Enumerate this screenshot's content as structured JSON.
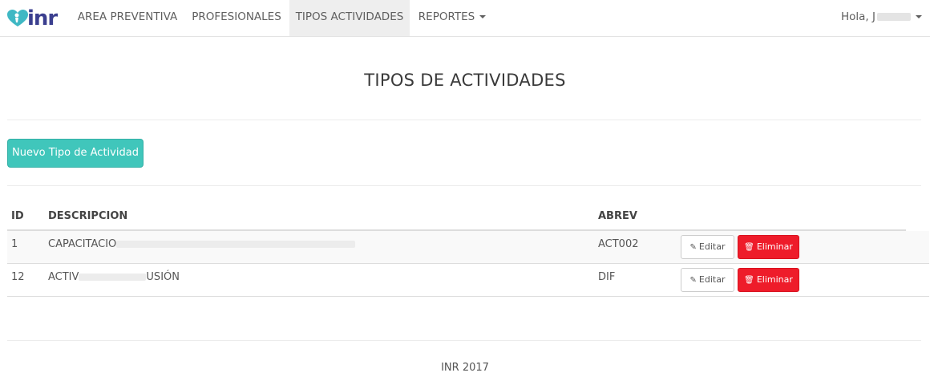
{
  "navbar": {
    "brand": "inr",
    "items": [
      {
        "label": "AREA PREVENTIVA"
      },
      {
        "label": "PROFESIONALES"
      },
      {
        "label": "TIPOS ACTIVIDADES"
      },
      {
        "label": "REPORTES"
      }
    ],
    "active_item": "TIPOS ACTIVIDADES",
    "user_greeting": "Hola, J"
  },
  "page": {
    "title": "TIPOS DE ACTIVIDADES",
    "new_button_label": "Nuevo Tipo de Actividad"
  },
  "table": {
    "columns": [
      "ID",
      "DESCRIPCION",
      "ABREV"
    ],
    "rows": [
      {
        "id": "1",
        "descripcion": "CAPACITACIO",
        "descripcion_tail": "",
        "abrev": "ACT002"
      },
      {
        "id": "12",
        "descripcion": "ACTIV",
        "descripcion_tail": "USIÓN",
        "abrev": "DIF"
      }
    ],
    "edit_label": "Editar",
    "delete_label": "Eliminar"
  },
  "footer": {
    "text": "INR 2017"
  },
  "colors": {
    "primary_button": "#40c6bb",
    "danger_button": "#ee1c2a",
    "brand": "#3b3f8f",
    "brand_mark": "#3fb8c4"
  },
  "icons": {
    "edit": "edit-icon",
    "delete": "trash-icon",
    "caret": "caret-down-icon"
  }
}
